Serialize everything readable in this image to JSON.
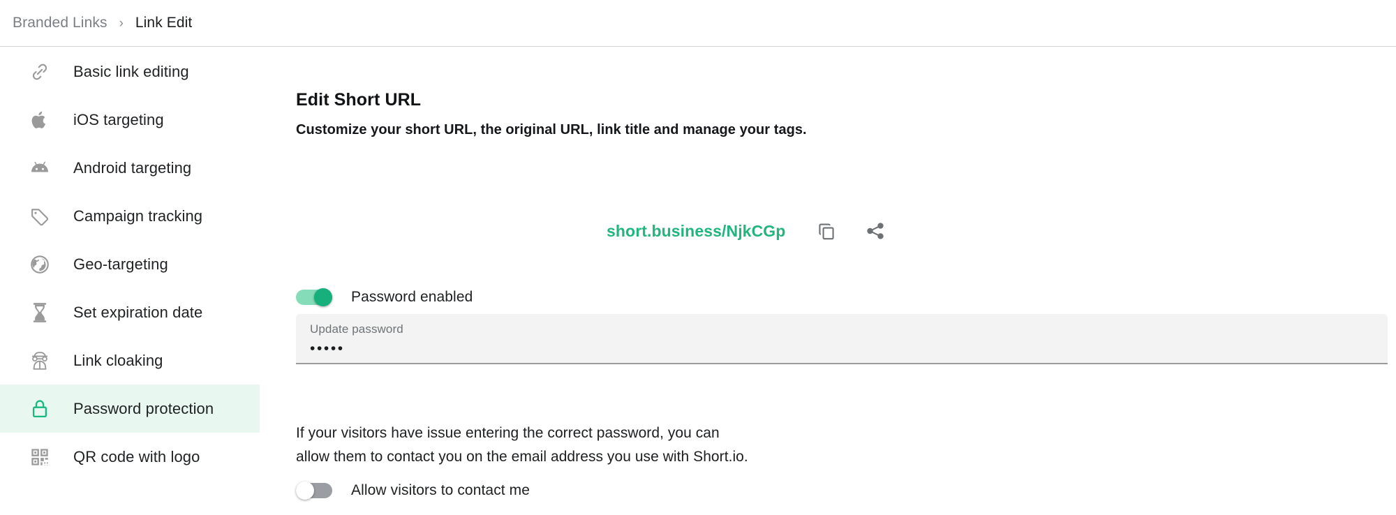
{
  "breadcrumb": {
    "root": "Branded Links",
    "separator": "›",
    "current": "Link Edit"
  },
  "sidebar": {
    "items": [
      {
        "label": "Basic link editing",
        "icon": "link-icon",
        "active": false
      },
      {
        "label": "iOS targeting",
        "icon": "apple-icon",
        "active": false
      },
      {
        "label": "Android targeting",
        "icon": "android-icon",
        "active": false
      },
      {
        "label": "Campaign tracking",
        "icon": "tag-icon",
        "active": false
      },
      {
        "label": "Geo-targeting",
        "icon": "globe-icon",
        "active": false
      },
      {
        "label": "Set expiration date",
        "icon": "hourglass-icon",
        "active": false
      },
      {
        "label": "Link cloaking",
        "icon": "spy-icon",
        "active": false
      },
      {
        "label": "Password protection",
        "icon": "lock-icon",
        "active": true
      },
      {
        "label": "QR code with logo",
        "icon": "qr-code-icon",
        "active": false
      }
    ]
  },
  "main": {
    "title": "Edit Short URL",
    "subtitle": "Customize your short URL, the original URL, link title and manage your tags.",
    "short_url": "short.business/NjkCGp",
    "copy_icon": "copy-icon",
    "share_icon": "share-icon",
    "password_toggle": {
      "label": "Password enabled",
      "state": "on"
    },
    "password_field": {
      "label": "Update password",
      "value": "•••••"
    },
    "helper_line_1": "If your visitors have issue entering the correct password, you can",
    "helper_line_2": "allow them to contact you on the email address you use with Short.io.",
    "contact_toggle": {
      "label": "Allow visitors to contact me",
      "state": "off"
    }
  },
  "colors": {
    "accent_green": "#22b57e",
    "active_row_bg": "#e9f7f1",
    "field_bg": "#f3f3f3",
    "muted_text": "#7b7f83"
  }
}
